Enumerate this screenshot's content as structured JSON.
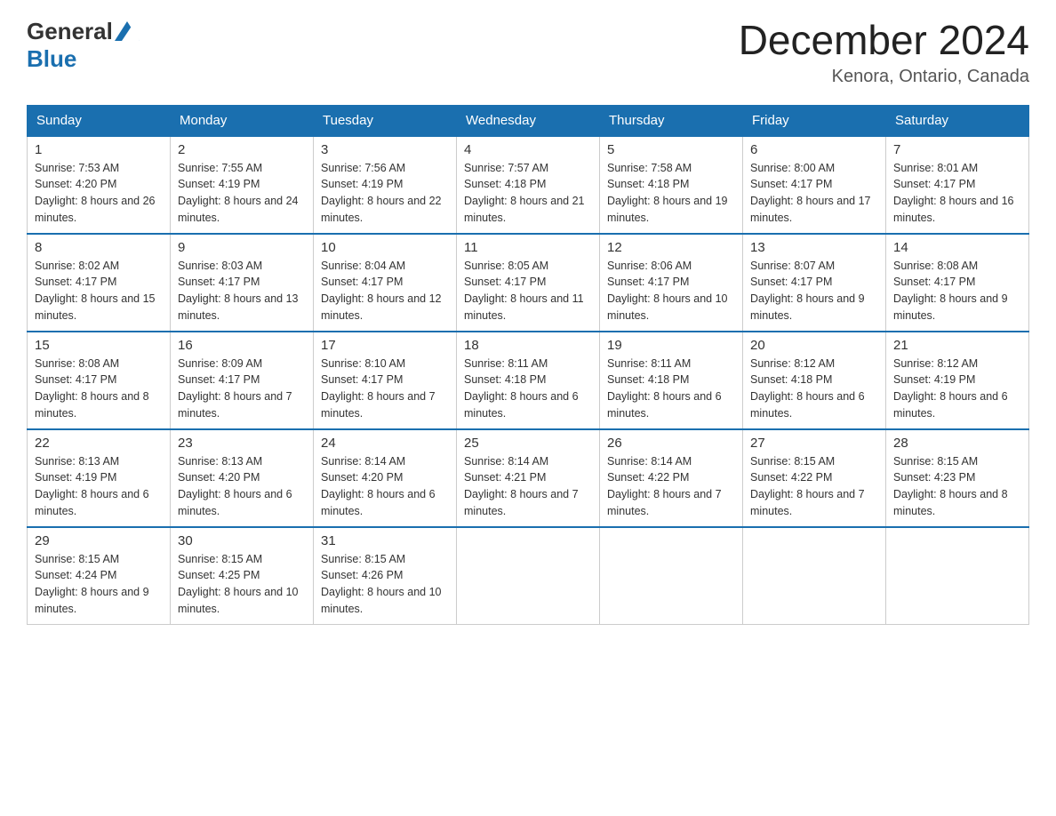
{
  "header": {
    "logo_general": "General",
    "logo_blue": "Blue",
    "month_title": "December 2024",
    "location": "Kenora, Ontario, Canada"
  },
  "days_of_week": [
    "Sunday",
    "Monday",
    "Tuesday",
    "Wednesday",
    "Thursday",
    "Friday",
    "Saturday"
  ],
  "weeks": [
    [
      {
        "day": "1",
        "sunrise": "7:53 AM",
        "sunset": "4:20 PM",
        "daylight": "8 hours and 26 minutes."
      },
      {
        "day": "2",
        "sunrise": "7:55 AM",
        "sunset": "4:19 PM",
        "daylight": "8 hours and 24 minutes."
      },
      {
        "day": "3",
        "sunrise": "7:56 AM",
        "sunset": "4:19 PM",
        "daylight": "8 hours and 22 minutes."
      },
      {
        "day": "4",
        "sunrise": "7:57 AM",
        "sunset": "4:18 PM",
        "daylight": "8 hours and 21 minutes."
      },
      {
        "day": "5",
        "sunrise": "7:58 AM",
        "sunset": "4:18 PM",
        "daylight": "8 hours and 19 minutes."
      },
      {
        "day": "6",
        "sunrise": "8:00 AM",
        "sunset": "4:17 PM",
        "daylight": "8 hours and 17 minutes."
      },
      {
        "day": "7",
        "sunrise": "8:01 AM",
        "sunset": "4:17 PM",
        "daylight": "8 hours and 16 minutes."
      }
    ],
    [
      {
        "day": "8",
        "sunrise": "8:02 AM",
        "sunset": "4:17 PM",
        "daylight": "8 hours and 15 minutes."
      },
      {
        "day": "9",
        "sunrise": "8:03 AM",
        "sunset": "4:17 PM",
        "daylight": "8 hours and 13 minutes."
      },
      {
        "day": "10",
        "sunrise": "8:04 AM",
        "sunset": "4:17 PM",
        "daylight": "8 hours and 12 minutes."
      },
      {
        "day": "11",
        "sunrise": "8:05 AM",
        "sunset": "4:17 PM",
        "daylight": "8 hours and 11 minutes."
      },
      {
        "day": "12",
        "sunrise": "8:06 AM",
        "sunset": "4:17 PM",
        "daylight": "8 hours and 10 minutes."
      },
      {
        "day": "13",
        "sunrise": "8:07 AM",
        "sunset": "4:17 PM",
        "daylight": "8 hours and 9 minutes."
      },
      {
        "day": "14",
        "sunrise": "8:08 AM",
        "sunset": "4:17 PM",
        "daylight": "8 hours and 9 minutes."
      }
    ],
    [
      {
        "day": "15",
        "sunrise": "8:08 AM",
        "sunset": "4:17 PM",
        "daylight": "8 hours and 8 minutes."
      },
      {
        "day": "16",
        "sunrise": "8:09 AM",
        "sunset": "4:17 PM",
        "daylight": "8 hours and 7 minutes."
      },
      {
        "day": "17",
        "sunrise": "8:10 AM",
        "sunset": "4:17 PM",
        "daylight": "8 hours and 7 minutes."
      },
      {
        "day": "18",
        "sunrise": "8:11 AM",
        "sunset": "4:18 PM",
        "daylight": "8 hours and 6 minutes."
      },
      {
        "day": "19",
        "sunrise": "8:11 AM",
        "sunset": "4:18 PM",
        "daylight": "8 hours and 6 minutes."
      },
      {
        "day": "20",
        "sunrise": "8:12 AM",
        "sunset": "4:18 PM",
        "daylight": "8 hours and 6 minutes."
      },
      {
        "day": "21",
        "sunrise": "8:12 AM",
        "sunset": "4:19 PM",
        "daylight": "8 hours and 6 minutes."
      }
    ],
    [
      {
        "day": "22",
        "sunrise": "8:13 AM",
        "sunset": "4:19 PM",
        "daylight": "8 hours and 6 minutes."
      },
      {
        "day": "23",
        "sunrise": "8:13 AM",
        "sunset": "4:20 PM",
        "daylight": "8 hours and 6 minutes."
      },
      {
        "day": "24",
        "sunrise": "8:14 AM",
        "sunset": "4:20 PM",
        "daylight": "8 hours and 6 minutes."
      },
      {
        "day": "25",
        "sunrise": "8:14 AM",
        "sunset": "4:21 PM",
        "daylight": "8 hours and 7 minutes."
      },
      {
        "day": "26",
        "sunrise": "8:14 AM",
        "sunset": "4:22 PM",
        "daylight": "8 hours and 7 minutes."
      },
      {
        "day": "27",
        "sunrise": "8:15 AM",
        "sunset": "4:22 PM",
        "daylight": "8 hours and 7 minutes."
      },
      {
        "day": "28",
        "sunrise": "8:15 AM",
        "sunset": "4:23 PM",
        "daylight": "8 hours and 8 minutes."
      }
    ],
    [
      {
        "day": "29",
        "sunrise": "8:15 AM",
        "sunset": "4:24 PM",
        "daylight": "8 hours and 9 minutes."
      },
      {
        "day": "30",
        "sunrise": "8:15 AM",
        "sunset": "4:25 PM",
        "daylight": "8 hours and 10 minutes."
      },
      {
        "day": "31",
        "sunrise": "8:15 AM",
        "sunset": "4:26 PM",
        "daylight": "8 hours and 10 minutes."
      },
      null,
      null,
      null,
      null
    ]
  ]
}
